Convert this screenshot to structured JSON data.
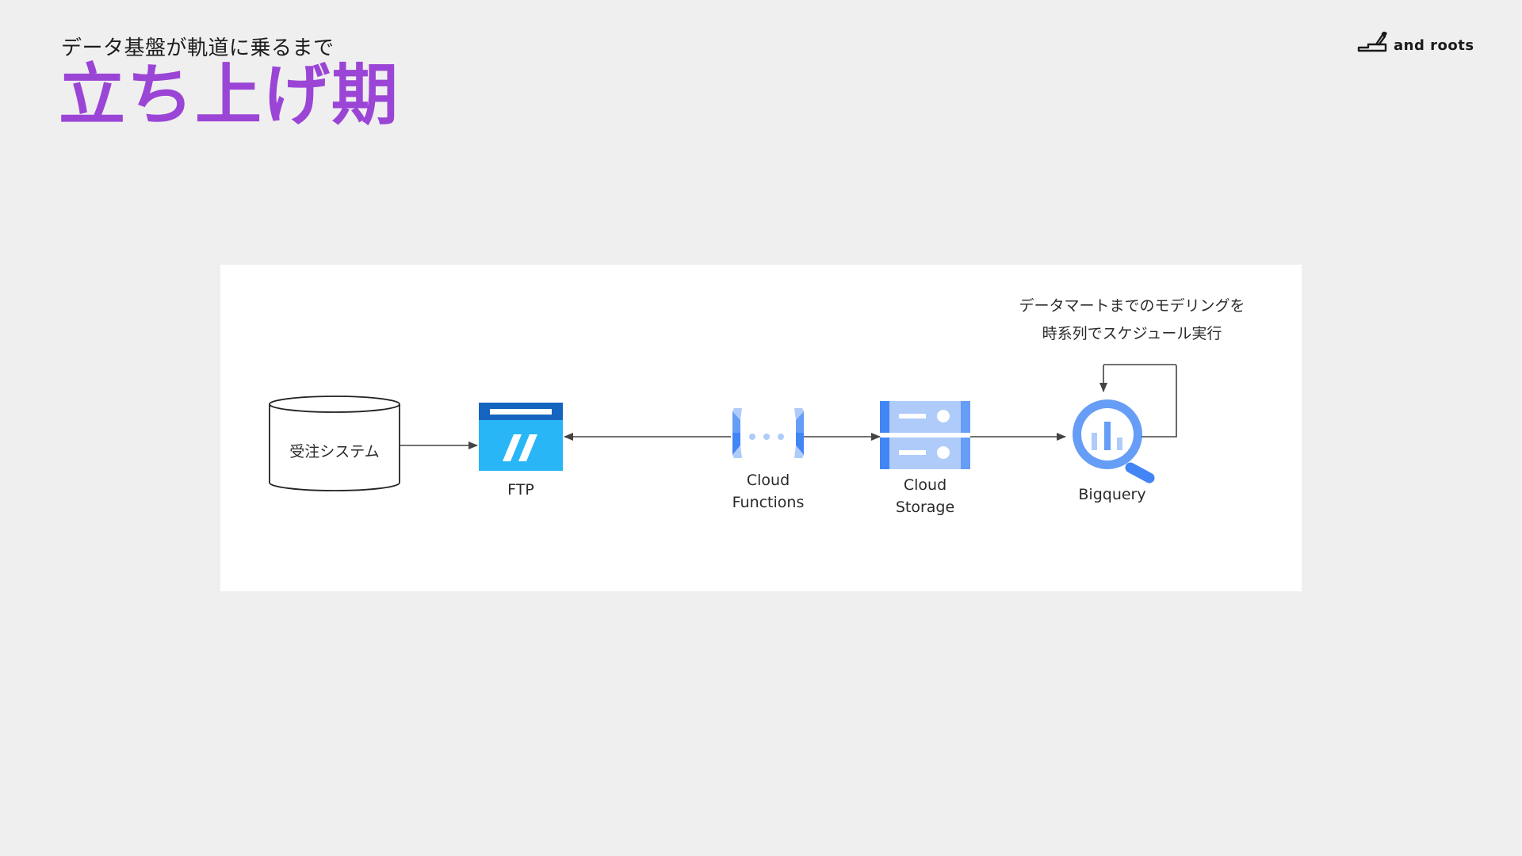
{
  "header": {
    "subtitle": "データ基盤が軌道に乗るまで",
    "title": "立ち上げ期",
    "title_color": "#9b45d6"
  },
  "logo": {
    "text": "and roots",
    "icon": "pen-tray-icon"
  },
  "diagram": {
    "nodes": {
      "order_system": "受注システム",
      "ftp": "FTP",
      "cloud_functions_1": "Cloud",
      "cloud_functions_2": "Functions",
      "cloud_storage_1": "Cloud",
      "cloud_storage_2": "Storage",
      "bigquery": "Bigquery"
    },
    "note_line1": "データマートまでのモデリングを",
    "note_line2": "時系列でスケジュール実行",
    "colors": {
      "ftp_top": "#1565c0",
      "ftp_body": "#29b6f6",
      "gcp_light": "#aecbfa",
      "gcp_mid": "#669df6",
      "gcp_dark": "#4285f4"
    }
  }
}
